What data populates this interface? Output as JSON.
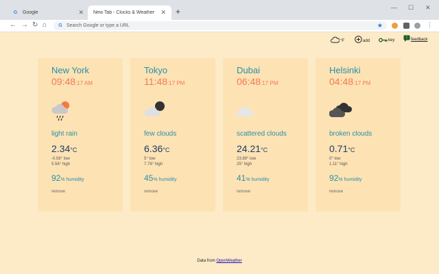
{
  "browser": {
    "tabs": [
      {
        "title": "Google",
        "active": false
      },
      {
        "title": "New Tab - Clocks & Weather",
        "active": true
      }
    ],
    "new_tab_label": "+",
    "omnibox_placeholder": "Search Google or type a URL"
  },
  "toolbar_icons": {
    "unit_label": "°F",
    "add_label": "add",
    "key_label": "key",
    "feedback_label": "feedback"
  },
  "cards": [
    {
      "city": "New York",
      "time": "09:48",
      "seconds_ampm": ":17 AM",
      "icon": "rain-cloud-icon",
      "description": "light rain",
      "temp": "2.34",
      "temp_unit": "°C",
      "low": "-0.56° low",
      "high": "5.56° high",
      "humidity": "92",
      "humidity_label": "% humidity",
      "remove": "remove"
    },
    {
      "city": "Tokyo",
      "time": "11:48",
      "seconds_ampm": ":17 PM",
      "icon": "few-clouds-night-icon",
      "description": "few clouds",
      "temp": "6.36",
      "temp_unit": "°C",
      "low": "5° low",
      "high": "7.78° high",
      "humidity": "45",
      "humidity_label": "% humidity",
      "remove": "remove"
    },
    {
      "city": "Dubai",
      "time": "06:48",
      "seconds_ampm": ":17 PM",
      "icon": "scattered-clouds-icon",
      "description": "scattered clouds",
      "temp": "24.21",
      "temp_unit": "°C",
      "low": "23.89° low",
      "high": "25° high",
      "humidity": "41",
      "humidity_label": "% humidity",
      "remove": "remove"
    },
    {
      "city": "Helsinki",
      "time": "04:48",
      "seconds_ampm": ":17 PM",
      "icon": "broken-clouds-icon",
      "description": "broken clouds",
      "temp": "0.71",
      "temp_unit": "°C",
      "low": "0° low",
      "high": "1.11° high",
      "humidity": "92",
      "humidity_label": "% humidity",
      "remove": "remove"
    }
  ],
  "footer": {
    "prefix": "Data from ",
    "link": "OpenWeather"
  },
  "colors": {
    "page_bg": "#fdebc8",
    "card_bg": "#fde2b4",
    "city": "#2a8fa8",
    "time": "#f07b50",
    "temp": "#1d3b66"
  }
}
